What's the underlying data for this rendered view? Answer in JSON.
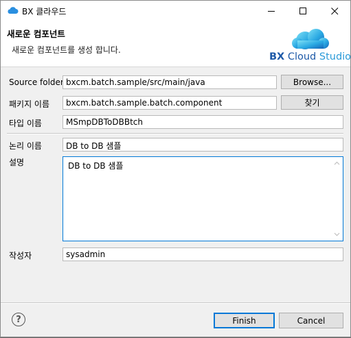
{
  "window": {
    "title": "BX 클라우드",
    "icon": "cloud-icon",
    "controls": [
      "minimize-icon",
      "maximize-icon",
      "close-icon"
    ]
  },
  "header": {
    "title": "새로운 컴포넌트",
    "description": "새로운 컴포넌트를 생성 합니다.",
    "logo": {
      "bx": "BX",
      "cloud": " Cloud",
      "studio": " Studio"
    }
  },
  "form": {
    "source_folder": {
      "label": "Source folder:",
      "value": "bxcm.batch.sample/src/main/java",
      "button": "Browse..."
    },
    "package_name": {
      "label": "패키지 이름",
      "value": "bxcm.batch.sample.batch.component",
      "button": "찾기"
    },
    "type_name": {
      "label": "타입 이름",
      "value": "MSmpDBToDBBtch"
    },
    "logical_name": {
      "label": "논리 이름",
      "value": "DB to DB 샘플"
    },
    "description": {
      "label": "설명",
      "value": "DB to DB 샘플"
    },
    "author": {
      "label": "작성자",
      "value": "sysadmin"
    }
  },
  "footer": {
    "help": "?",
    "finish": "Finish",
    "cancel": "Cancel"
  },
  "colors": {
    "accent_border": "#0078d7",
    "logo_dark_blue": "#1e5aa8",
    "logo_light_blue": "#2a9ad8"
  }
}
